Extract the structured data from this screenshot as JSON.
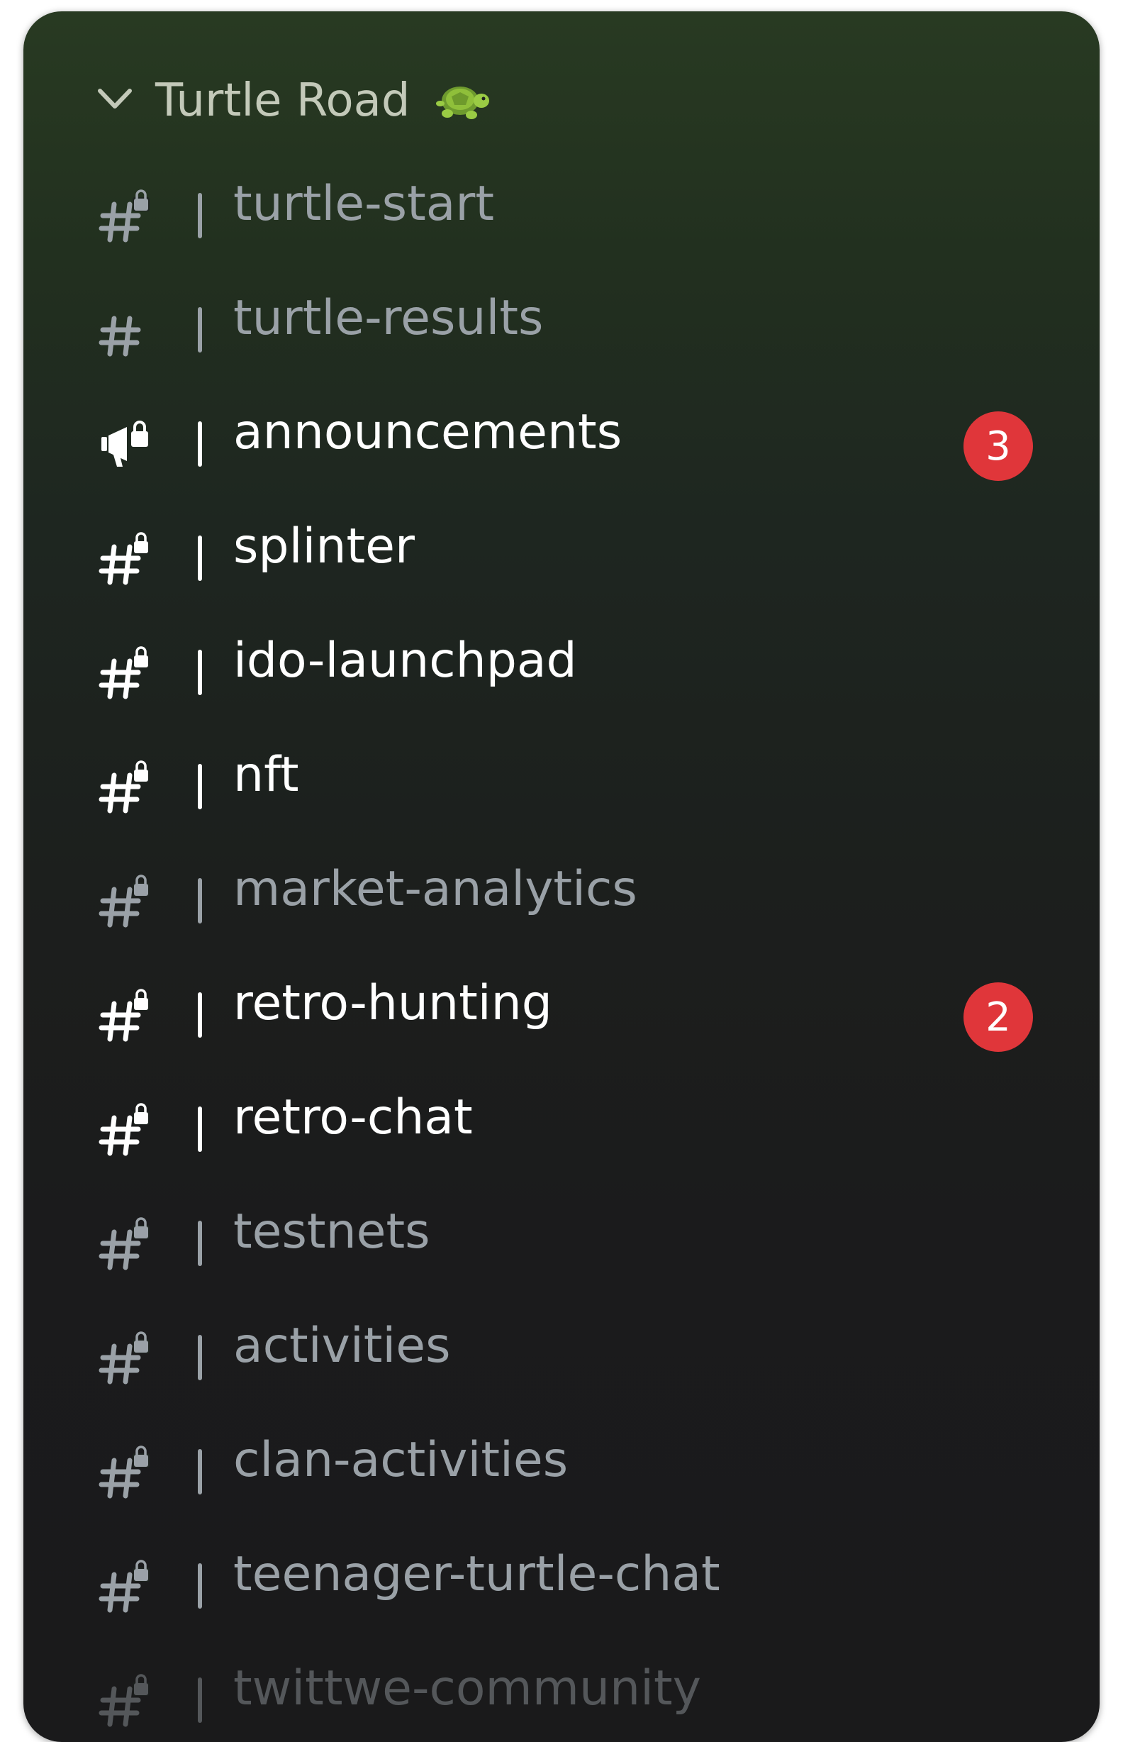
{
  "category": {
    "label": "Turtle Road",
    "emoji": "🐢",
    "expanded": true
  },
  "colors": {
    "unread_text": "#ffffff",
    "read_text": "#9aa1a7",
    "badge": "#e0363a"
  },
  "channels": [
    {
      "name": "turtle-start",
      "icon": "hash-lock-icon",
      "state": "read",
      "badge": null
    },
    {
      "name": "turtle-results",
      "icon": "hash-icon",
      "state": "read",
      "badge": null
    },
    {
      "name": "announcements",
      "icon": "megaphone-lock-icon",
      "state": "unread",
      "badge": "3"
    },
    {
      "name": "splinter",
      "icon": "hash-lock-icon",
      "state": "unread",
      "badge": null
    },
    {
      "name": "ido-launchpad",
      "icon": "hash-lock-icon",
      "state": "unread",
      "badge": null
    },
    {
      "name": "nft",
      "icon": "hash-lock-icon",
      "state": "unread",
      "badge": null
    },
    {
      "name": "market-analytics",
      "icon": "hash-lock-icon",
      "state": "read",
      "badge": null
    },
    {
      "name": "retro-hunting",
      "icon": "hash-lock-icon",
      "state": "unread",
      "badge": "2"
    },
    {
      "name": "retro-chat",
      "icon": "hash-lock-icon",
      "state": "unread",
      "badge": null
    },
    {
      "name": "testnets",
      "icon": "hash-lock-icon",
      "state": "read",
      "badge": null
    },
    {
      "name": "activities",
      "icon": "hash-lock-icon",
      "state": "read",
      "badge": null
    },
    {
      "name": "clan-activities",
      "icon": "hash-lock-icon",
      "state": "read",
      "badge": null
    },
    {
      "name": "teenager-turtle-chat",
      "icon": "hash-lock-icon",
      "state": "read",
      "badge": null
    },
    {
      "name": "twittwe-community",
      "icon": "hash-lock-icon",
      "state": "read",
      "badge": null
    }
  ]
}
